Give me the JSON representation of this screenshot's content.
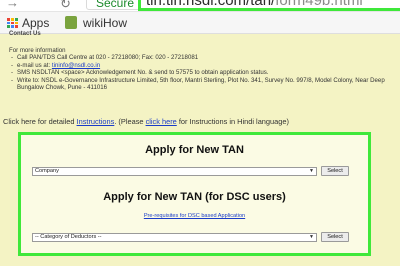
{
  "browser": {
    "secure_label": "Secure",
    "url_main": "tin.tin.nsdl.com/tan/",
    "url_dim": "form49b.html",
    "forward_icon": "forward-arrow-icon",
    "reload_icon": "reload-icon",
    "accent_color": "#3fe83a"
  },
  "bookmarks": {
    "apps_label": "Apps",
    "wikihow_label": "wikiHow"
  },
  "contact": {
    "heading": "Contact Us",
    "intro": "For more information",
    "items": [
      {
        "pre": "Call PAN/TDS Call Centre at 020 - 27218080; Fax: 020 - 27218081"
      },
      {
        "pre": "e-mail us at: ",
        "link": "tininfo@nsdl.co.in"
      },
      {
        "pre": "SMS NSDLTAN <space> Acknowledgement No. & send to 57575 to obtain application status."
      },
      {
        "pre": "Write to: NSDL e-Governance Infrastructure Limited, 5th floor, Mantri Sterling, Plot No. 341, Survey No. 997/8, Model Colony, Near Deep Bungalow Chowk, Pune - 411016"
      }
    ]
  },
  "instructions": {
    "pre": "Click here for detailed ",
    "link1": "Instructions",
    "mid": ". (Please ",
    "link2": "click here",
    "post": " for Instructions in Hindi language)"
  },
  "form_tan": {
    "title": "Apply for New TAN",
    "select_value": "Company",
    "button_label": "Select"
  },
  "form_dsc": {
    "title": "Apply for New TAN (for DSC users)",
    "prereq_link": "Pre-requisites for DSC based Application",
    "select_value": "-- Category of Deductors --",
    "button_label": "Select"
  }
}
